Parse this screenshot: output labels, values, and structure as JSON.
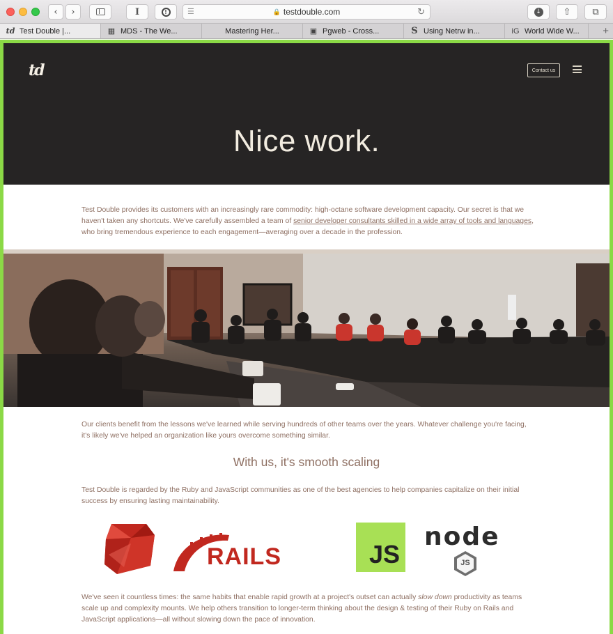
{
  "browser": {
    "url": "testdouble.com",
    "tabs": [
      {
        "label": "Test Double |...",
        "favicon": "td",
        "active": true
      },
      {
        "label": "MDS - The We...",
        "favicon": "▦",
        "active": false
      },
      {
        "label": "Mastering Her...",
        "favicon": "",
        "active": false
      },
      {
        "label": "Pgweb - Cross...",
        "favicon": "▣",
        "active": false
      },
      {
        "label": "Using Netrw in...",
        "favicon": "S",
        "active": false
      },
      {
        "label": "World Wide W...",
        "favicon": "iG",
        "active": false
      }
    ]
  },
  "header": {
    "logo": "td",
    "contact_label": "Contact us",
    "title": "Nice work."
  },
  "intro": {
    "text_before_link": "Test Double provides its customers with an increasingly rare commodity: high-octane software development capacity. Our secret is that we haven't taken any shortcuts. We've carefully assembled a team of ",
    "link_text": "senior developer consultants skilled in a wide array of tools and languages",
    "text_after_link": ", who bring tremendous experience to each engagement—averaging over a decade in the profession."
  },
  "clients_paragraph": "Our clients benefit from the lessons we've learned while serving hundreds of other teams over the years. Whatever challenge you're facing, it's likely we've helped an organization like yours overcome something similar.",
  "scaling": {
    "heading": "With us, it's smooth scaling",
    "paragraph": "Test Double is regarded by the Ruby and JavaScript communities as one of the best agencies to help companies capitalize on their initial success by ensuring lasting maintainability."
  },
  "tech_logos": {
    "rails_text": "RAILS",
    "js_text": "JS",
    "node_text": "node",
    "node_badge": "JS"
  },
  "closing": {
    "text_before_em": "We've seen it countless times: the same habits that enable rapid growth at a project's outset can actually ",
    "em_text": "slow down",
    "text_after_em": " productivity as teams scale up and complexity mounts. We help others transition to longer-term thinking about the design & testing of their Ruby on Rails and JavaScript applications—all without slowing down the pace of innovation."
  },
  "colors": {
    "hero_bg": "#262424",
    "body_text": "#8e6f62",
    "ruby_red": "#c1281f",
    "js_yellow": "#a8e055",
    "viewport_outline": "#8bd946"
  }
}
